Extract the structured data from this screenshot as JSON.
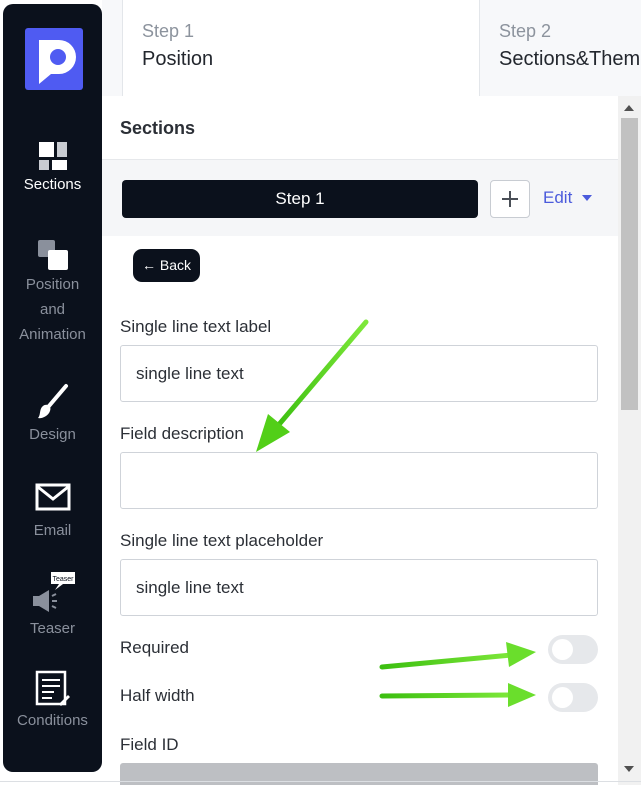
{
  "sidebar": {
    "items": [
      {
        "label": "Sections",
        "icon": "sections-icon",
        "active": true
      },
      {
        "label": "Position and Animation",
        "icon": "position-animation-icon",
        "active": false
      },
      {
        "label": "Design",
        "icon": "paintbrush-icon",
        "active": false
      },
      {
        "label": "Email",
        "icon": "envelope-icon",
        "active": false
      },
      {
        "label": "Teaser",
        "icon": "megaphone-icon",
        "badge": "Teaser",
        "active": false
      },
      {
        "label": "Conditions",
        "icon": "conditions-icon",
        "active": false
      }
    ]
  },
  "steps": [
    {
      "number": "Step 1",
      "name": "Position"
    },
    {
      "number": "Step 2",
      "name": "Sections&Theme"
    }
  ],
  "panel": {
    "title": "Sections",
    "step_select": "Step 1",
    "plus_label": "+",
    "edit_label": "Edit",
    "back_label": "← Back"
  },
  "form": {
    "label_field": {
      "label": "Single line text label",
      "value": "single line text"
    },
    "description_field": {
      "label": "Field description",
      "value": ""
    },
    "placeholder_field": {
      "label": "Single line text placeholder",
      "value": "single line text"
    },
    "required": {
      "label": "Required",
      "on": false
    },
    "half_width": {
      "label": "Half width",
      "on": false
    },
    "field_id": {
      "label": "Field ID",
      "value": ""
    }
  },
  "colors": {
    "sidebar_bg": "#0b111c",
    "logo": "#4f5bf2",
    "accent_link": "#4b5bdc",
    "annotation_arrow": "#5ad71c"
  }
}
